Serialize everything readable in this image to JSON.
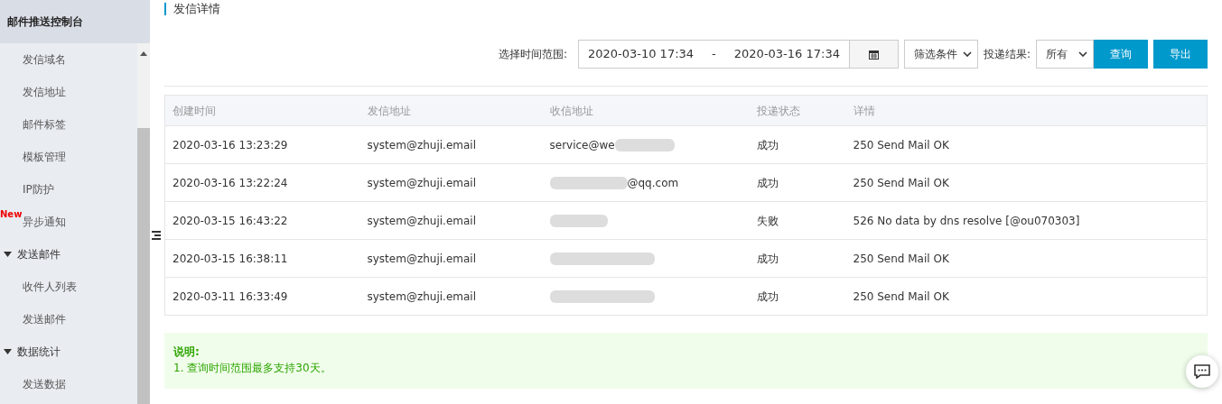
{
  "sidebar": {
    "title": "邮件推送控制台",
    "items": [
      {
        "label": "发信域名",
        "kind": "item"
      },
      {
        "label": "发信地址",
        "kind": "item"
      },
      {
        "label": "邮件标签",
        "kind": "item"
      },
      {
        "label": "模板管理",
        "kind": "item"
      },
      {
        "label": "IP防护",
        "kind": "item"
      },
      {
        "label": "异步通知",
        "kind": "item",
        "badge": "New"
      },
      {
        "label": "发送邮件",
        "kind": "group",
        "expanded": true
      },
      {
        "label": "收件人列表",
        "kind": "item"
      },
      {
        "label": "发送邮件",
        "kind": "item"
      },
      {
        "label": "数据统计",
        "kind": "group",
        "expanded": true
      },
      {
        "label": "发送数据",
        "kind": "item"
      }
    ]
  },
  "page_title": "发信详情",
  "filters": {
    "range_label": "选择时间范围:",
    "start": "2020-03-10 17:34",
    "separator": "-",
    "end": "2020-03-16 17:34",
    "condition": "筛选条件",
    "result_label": "投递结果:",
    "result": "所有",
    "buttons": [
      "查询",
      "导出"
    ]
  },
  "table": {
    "columns": [
      "创建时间",
      "发信地址",
      "收信地址",
      "投递状态",
      "详情"
    ],
    "rows": [
      {
        "time": "2020-03-16 13:23:29",
        "from": "system@zhuji.email",
        "to": "service@we",
        "kind": "tail",
        "status": "成功",
        "detail": "250 Send Mail OK"
      },
      {
        "time": "2020-03-16 13:22:24",
        "from": "system@zhuji.email",
        "to": "@qq.com",
        "kind": "head",
        "status": "成功",
        "detail": "250 Send Mail OK"
      },
      {
        "time": "2020-03-15 16:43:22",
        "from": "system@zhuji.email",
        "kind": "short",
        "status": "失败",
        "detail": "526 No data by dns resolve [@ou070303]"
      },
      {
        "time": "2020-03-15 16:38:11",
        "from": "system@zhuji.email",
        "kind": "full",
        "status": "成功",
        "detail": "250 Send Mail OK"
      },
      {
        "time": "2020-03-11 16:33:49",
        "from": "system@zhuji.email",
        "kind": "full",
        "status": "成功",
        "detail": "250 Send Mail OK"
      }
    ]
  },
  "note": {
    "title": "说明:",
    "lines": [
      "1. 查询时间范围最多支持30天。"
    ]
  }
}
